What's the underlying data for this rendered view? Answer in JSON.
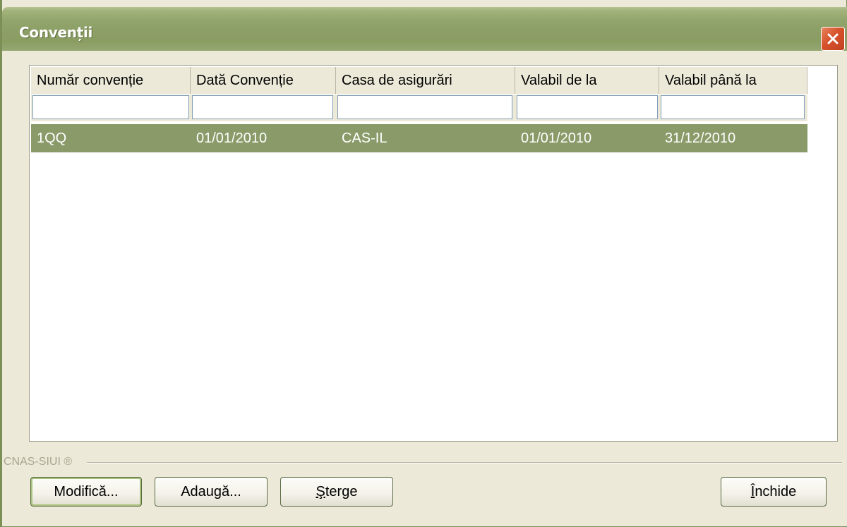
{
  "window": {
    "title": "Convenții",
    "close_icon": "close-icon"
  },
  "grid": {
    "columns": [
      "Număr convenție",
      "Dată Convenție",
      "Casa de asigurări",
      "Valabil de la",
      "Valabil până la"
    ],
    "filters": [
      "",
      "",
      "",
      "",
      ""
    ],
    "rows": [
      {
        "numar": "1QQ",
        "data": "01/01/2010",
        "casa": "CAS-IL",
        "valabil_de_la": "01/01/2010",
        "valabil_pana_la": "31/12/2010",
        "selected": true
      }
    ],
    "selection_color": "#8a9a68"
  },
  "footer": {
    "brand": "CNAS-SIUI ®"
  },
  "buttons": {
    "modify": "Modifică...",
    "add": "Adaugă...",
    "delete_first": "Ş",
    "delete_rest": "terge",
    "close_first": "Î",
    "close_rest": "nchide"
  }
}
